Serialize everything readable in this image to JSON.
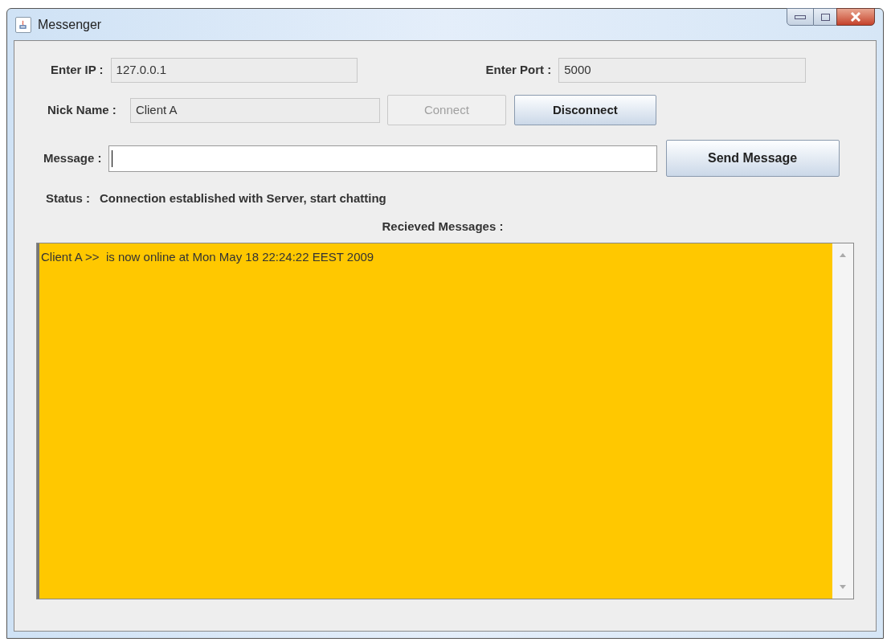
{
  "window": {
    "title": "Messenger"
  },
  "ip": {
    "label": "Enter IP :",
    "value": "127.0.0.1"
  },
  "port": {
    "label": "Enter Port :",
    "value": "5000"
  },
  "nick": {
    "label": "Nick Name :",
    "value": "Client A"
  },
  "buttons": [
    {
      "label": "Connect",
      "disabled": true
    },
    {
      "label": "Disconnect",
      "disabled": false
    }
  ],
  "message": {
    "label": "Message :",
    "send": "Send Message"
  },
  "status": {
    "label": "Status :",
    "text": "Connection established with Server, start chatting"
  },
  "received": {
    "label": "Recieved Messages :",
    "lines": [
      "Client A >>  is now online at Mon May 18 22:24:22 EEST 2009"
    ]
  }
}
